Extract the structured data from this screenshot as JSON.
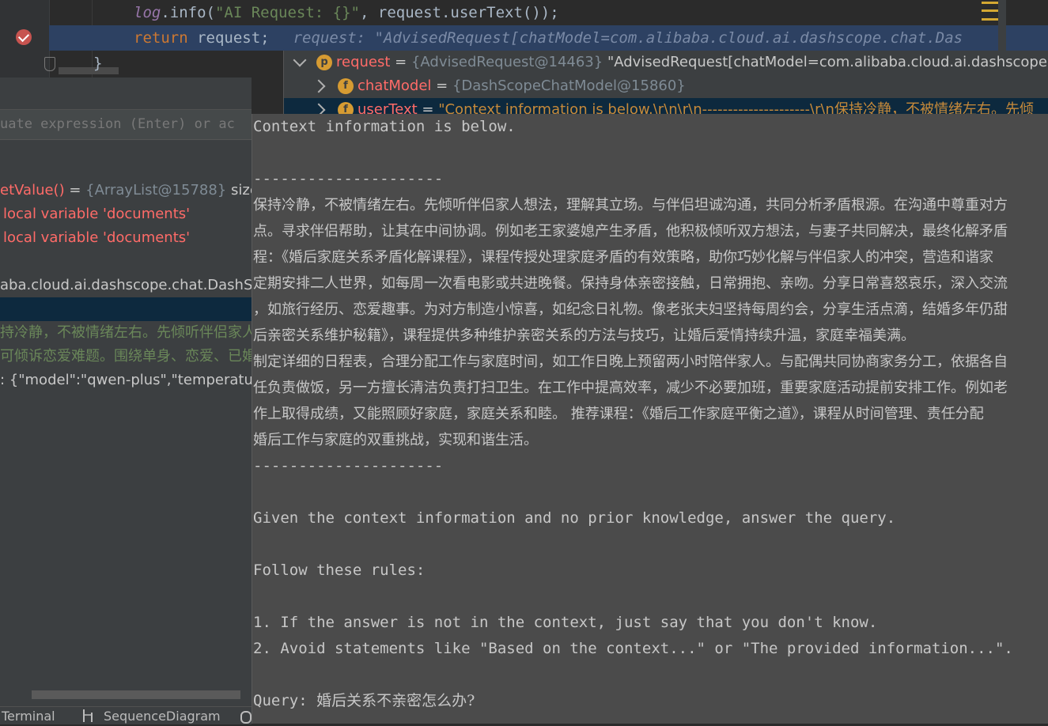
{
  "editor": {
    "line1": {
      "obj": "log",
      "method": ".info(",
      "string": "\"AI Request: {}\"",
      "rest": ", request.userText());"
    },
    "line2": {
      "keyword": "return",
      "code": " request;",
      "inline_value": "request: \"AdvisedRequest[chatModel=com.alibaba.cloud.ai.dashscope.chat.Das"
    },
    "line3": {
      "code": "}"
    }
  },
  "tree": {
    "row1": {
      "name": "request",
      "eq": " = ",
      "ref": "{AdvisedRequest@14463}",
      "value": " \"AdvisedRequest[chatModel=com.alibaba.cloud.ai.dashscope.chat.D"
    },
    "row2": {
      "name": "chatModel",
      "eq": " = ",
      "ref": "{DashScopeChatModel@15860}"
    },
    "row3": {
      "name": "userText",
      "eq": " = ",
      "value": "\"Context information is below.\\r\\n\\r\\n---------------------\\r\\n保持冷静，不被情绪左右。先倾"
    }
  },
  "left_panel": {
    "eval_placeholder": "uate expression (Enter) or ac",
    "rows": [
      {
        "name": "etValue()",
        "eq": " = ",
        "ref": "{ArrayList@15788}",
        "extra": "  size ="
      },
      {
        "error": "local variable 'documents'"
      },
      {
        "error": "local variable 'documents'"
      },
      {
        "text": ""
      },
      {
        "text": "aba.cloud.ai.dashscope.chat.DashScopeC"
      },
      {
        "text": ""
      },
      {
        "green": "持冷静，不被情绪左右。先倾听伴侣家人"
      },
      {
        "green": "可倾诉恋爱难题。围绕单身、恋爱、已婚"
      },
      {
        "text": ": {\"model\":\"qwen-plus\",\"temperature"
      }
    ]
  },
  "bottom_bar": {
    "terminal": "Terminal",
    "sequence": "SequenceDiagram"
  },
  "popup_text": {
    "lines": [
      {
        "t": "Context information is below.",
        "k": "m"
      },
      {
        "t": "",
        "k": "m"
      },
      {
        "t": "---------------------",
        "k": "m"
      },
      {
        "t": "保持冷静，不被情绪左右。先倾听伴侣家人想法，理解其立场。与伴侣坦诚沟通，共同分析矛盾根源。在沟通中尊重对方",
        "k": "c"
      },
      {
        "t": " 点。寻求伴侣帮助，让其在中间协调。例如老王家婆媳产生矛盾，他积极倾听双方想法，与妻子共同解决，最终化解矛盾",
        "k": "c"
      },
      {
        "t": " 程：《婚后家庭关系矛盾化解课程》，课程传授处理家庭矛盾的有效策略，助你巧妙化解与伴侣家人的冲突，营造和谐家",
        "k": "c"
      },
      {
        "t": "定期安排二人世界，如每周一次看电影或共进晚餐。保持身体亲密接触，日常拥抱、亲吻。分享日常喜怒哀乐，深入交流",
        "k": "c"
      },
      {
        "t": " ，如旅行经历、恋爱趣事。为对方制造小惊喜，如纪念日礼物。像老张夫妇坚持每周约会，分享生活点滴，结婚多年仍甜",
        "k": "c"
      },
      {
        "t": " 后亲密关系维护秘籍》，课程提供多种维护亲密关系的方法与技巧，让婚后爱情持续升温，家庭幸福美满。",
        "k": "c"
      },
      {
        "t": "制定详细的日程表，合理分配工作与家庭时间，如工作日晚上预留两小时陪伴家人。与配偶共同协商家务分工，依据各自",
        "k": "c"
      },
      {
        "t": " 任负责做饭，另一方擅长清洁负责打扫卫生。在工作中提高效率，减少不必要加班，重要家庭活动提前安排工作。例如老",
        "k": "c"
      },
      {
        "t": " 作上取得成绩，又能照顾好家庭，家庭关系和睦。 推荐课程：《婚后工作家庭平衡之道》，课程从时间管理、责任分配",
        "k": "c"
      },
      {
        "t": " 婚后工作与家庭的双重挑战，实现和谐生活。",
        "k": "c"
      },
      {
        "t": "---------------------",
        "k": "m"
      },
      {
        "t": "",
        "k": "m"
      },
      {
        "t": "Given the context information and no prior knowledge, answer the query.",
        "k": "m"
      },
      {
        "t": "",
        "k": "m"
      },
      {
        "t": "Follow these rules:",
        "k": "m"
      },
      {
        "t": "",
        "k": "m"
      },
      {
        "t": "1. If the answer is not in the context, just say that you don't know.",
        "k": "m"
      },
      {
        "t": "2. Avoid statements like \"Based on the context...\" or \"The provided information...\".",
        "k": "m"
      },
      {
        "t": "",
        "k": "m"
      },
      {
        "t": "Query: ",
        "k": "m",
        "suffix": "婚后关系不亲密怎么办?"
      }
    ]
  }
}
